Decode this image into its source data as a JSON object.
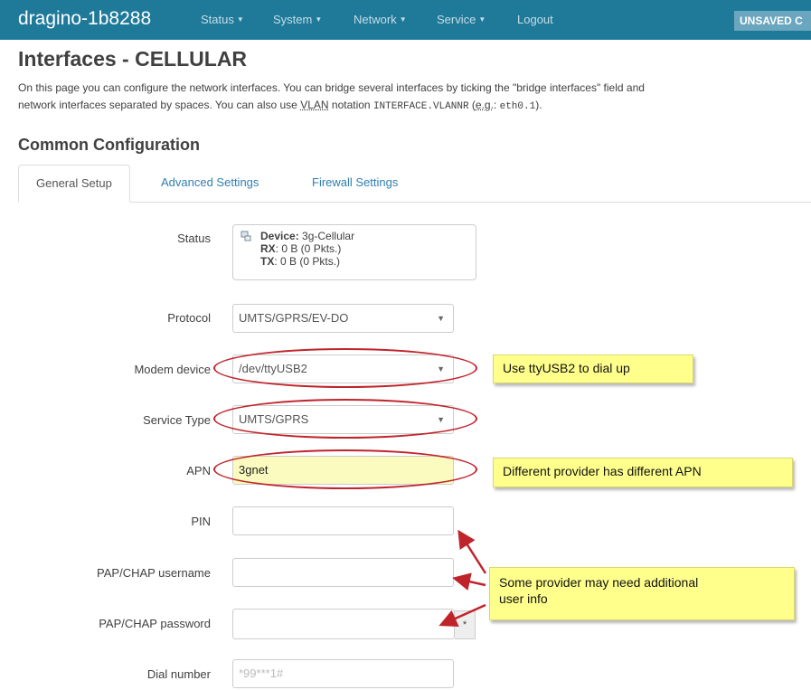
{
  "navbar": {
    "brand": "dragino-1b8288",
    "menus": [
      "Status",
      "System",
      "Network",
      "Service"
    ],
    "logout": "Logout",
    "unsaved": "UNSAVED C"
  },
  "page": {
    "title": "Interfaces - CELLULAR",
    "intro_line1": "On this page you can configure the network interfaces. You can bridge several interfaces by ticking the \"bridge interfaces\" field and",
    "intro_line2_a": "network interfaces separated by spaces. You can also use ",
    "intro_vlan": "VLAN",
    "intro_line2_b": " notation ",
    "intro_code1": "INTERFACE.VLANNR",
    "intro_line2_c": " (",
    "intro_eg": "e.g.",
    "intro_line2_d": ": ",
    "intro_code2": "eth0.1",
    "intro_line2_e": ").",
    "section_title": "Common Configuration"
  },
  "tabs": [
    "General Setup",
    "Advanced Settings",
    "Firewall Settings"
  ],
  "form": {
    "status_label": "Status",
    "status_device_label": "Device:",
    "status_device_value": "3g-Cellular",
    "status_rx_label": "RX",
    "status_rx_value": ": 0 B (0 Pkts.)",
    "status_tx_label": "TX",
    "status_tx_value": ": 0 B (0 Pkts.)",
    "protocol_label": "Protocol",
    "protocol_value": "UMTS/GPRS/EV-DO",
    "modem_label": "Modem device",
    "modem_value": "/dev/ttyUSB2",
    "service_label": "Service Type",
    "service_value": "UMTS/GPRS",
    "apn_label": "APN",
    "apn_value": "3gnet",
    "pin_label": "PIN",
    "pin_value": "",
    "username_label": "PAP/CHAP username",
    "username_value": "",
    "password_label": "PAP/CHAP password",
    "password_value": "",
    "password_toggle": "*",
    "dial_label": "Dial number",
    "dial_placeholder": "*99***1#"
  },
  "annotations": {
    "modem_note": "Use  ttyUSB2 to dial up",
    "apn_note": "Different  provider has different APN",
    "user_note_1": "Some provider may need additional",
    "user_note_2": "user info",
    "accent_color": "#c0242b"
  }
}
